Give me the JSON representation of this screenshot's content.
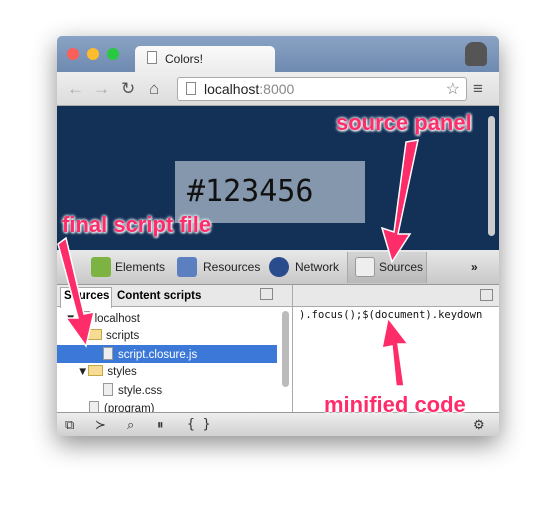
{
  "browser": {
    "tab_title": "Colors!",
    "url_host": "localhost",
    "url_port": ":8000"
  },
  "page": {
    "color_text": "#123456",
    "background": "#123456"
  },
  "devtools": {
    "panels": [
      "Elements",
      "Resources",
      "Network",
      "Sources"
    ],
    "more": "»",
    "subtabs": [
      "Sources",
      "Content scripts"
    ],
    "tree": [
      {
        "label": "localhost",
        "type": "host",
        "open": true
      },
      {
        "label": "scripts",
        "type": "folder"
      },
      {
        "label": "script.closure.js",
        "type": "file",
        "selected": true
      },
      {
        "label": "styles",
        "type": "folder",
        "open": true
      },
      {
        "label": "style.css",
        "type": "file"
      },
      {
        "label": "(program)",
        "type": "file"
      }
    ],
    "code": ").focus();$(document).keydown",
    "bottom": {
      "pretty_print": "{ }"
    }
  },
  "annotations": {
    "source_panel": "source panel",
    "final_script": "final script file",
    "minified": "minified code"
  },
  "colors": {
    "accent": "#ff2c6a",
    "selection": "#3b78d8"
  }
}
